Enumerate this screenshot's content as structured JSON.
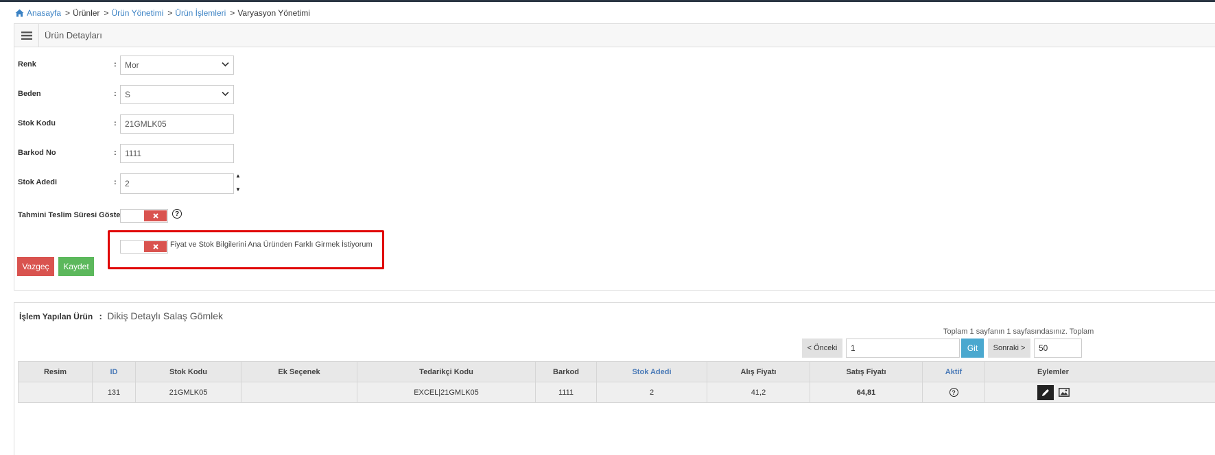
{
  "breadcrumb": {
    "home": "Anasayfa",
    "sep": ">",
    "items": [
      "Ürünler",
      "Ürün Yönetimi",
      "Ürün İşlemleri",
      "Varyasyon Yönetimi"
    ]
  },
  "panel": {
    "title": "Ürün Detayları"
  },
  "form": {
    "colon": ":",
    "renk": {
      "label": "Renk",
      "value": "Mor"
    },
    "beden": {
      "label": "Beden",
      "value": "S"
    },
    "stok_kodu": {
      "label": "Stok Kodu",
      "value": "21GMLK05"
    },
    "barkod_no": {
      "label": "Barkod No",
      "value": "1111"
    },
    "stok_adedi": {
      "label": "Stok Adedi",
      "value": "2"
    },
    "teslim": {
      "label": "Tahmini Teslim Süresi Göster"
    },
    "farkli_text": "Fiyat ve Stok Bilgilerini Ana Üründen Farklı Girmek İstiyorum",
    "cancel": "Vazgeç",
    "save": "Kaydet"
  },
  "product": {
    "label": "İşlem Yapılan Ürün",
    "colon": ":",
    "name": "Dikiş Detaylı Salaş Gömlek"
  },
  "pager": {
    "info": "Toplam 1 sayfanın 1 sayfasındasınız. Toplam",
    "prev": "< Önceki",
    "page": "1",
    "go": "Git",
    "next": "Sonraki >",
    "page_size": "50"
  },
  "table": {
    "headers": [
      "Resim",
      "ID",
      "Stok Kodu",
      "Ek Seçenek",
      "Tedarikçi Kodu",
      "Barkod",
      "Stok Adedi",
      "Alış Fiyatı",
      "Satış Fiyatı",
      "Aktif",
      "Eylemler"
    ],
    "rows": [
      {
        "resim": "",
        "id": "131",
        "stok_kodu": "21GMLK05",
        "ek": "",
        "tedarikci": "EXCEL|21GMLK05",
        "barkod": "1111",
        "stok": "2",
        "alis": "41,2",
        "satis": "64,81"
      }
    ]
  },
  "icons": {
    "home": "home-icon",
    "menu": "hamburger-icon",
    "help": "question-circle-icon",
    "edit": "pencil-icon",
    "image": "image-icon",
    "toggle_off": "x-icon"
  },
  "colors": {
    "link": "#3b82c4",
    "danger": "#d9534f",
    "success": "#5cb85c",
    "info": "#4aa8cf",
    "highlight": "#e00000"
  }
}
